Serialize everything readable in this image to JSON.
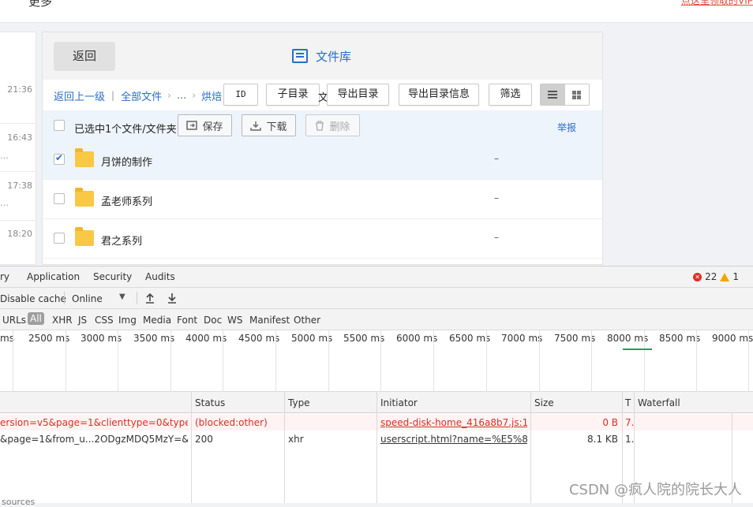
{
  "topbar": {
    "left_text": "更多",
    "right_text": "点这里领取的VIP"
  },
  "chat_list": {
    "times": [
      "21:36",
      "16:43",
      "17:38",
      "18:20"
    ],
    "dots": "…"
  },
  "file_panel": {
    "back_label": "返回",
    "title": "文件库",
    "breadcrumb": {
      "up": "返回上一级",
      "all": "全部文件",
      "dots": "...",
      "current": "烘焙"
    },
    "toolbar": {
      "id": "ID",
      "subdir": "子目录",
      "partial": "文",
      "export_dir": "导出目录",
      "export_dir_info": "导出目录信息",
      "filter": "筛选"
    },
    "selection": {
      "text": "已选中1个文件/文件夹",
      "save": "保存",
      "download": "下载",
      "delete": "删除",
      "report": "举报"
    },
    "rows": [
      {
        "name": "月饼的制作",
        "dash": "–",
        "checked": true
      },
      {
        "name": "孟老师系列",
        "dash": "–",
        "checked": false
      },
      {
        "name": "君之系列",
        "dash": "–",
        "checked": false
      }
    ]
  },
  "devtools": {
    "tabs": [
      "ry",
      "Application",
      "Security",
      "Audits"
    ],
    "errors": "22",
    "warnings": "1",
    "toolbar": {
      "disable_cache": "Disable cache",
      "throttle": "Online"
    },
    "filters": [
      "URLs",
      "All",
      "XHR",
      "JS",
      "CSS",
      "Img",
      "Media",
      "Font",
      "Doc",
      "WS",
      "Manifest",
      "Other"
    ],
    "timeline_ticks": [
      "ms",
      "2500 ms",
      "3000 ms",
      "3500 ms",
      "4000 ms",
      "4500 ms",
      "5000 ms",
      "5500 ms",
      "6000 ms",
      "6500 ms",
      "7000 ms",
      "7500 ms",
      "8000 ms",
      "8500 ms",
      "9000 ms"
    ],
    "columns": [
      "Status",
      "Type",
      "Initiator",
      "Size",
      "T",
      "Waterfall"
    ],
    "requests": [
      {
        "name": "ersion=v5&page=1&clienttype=0&type=...",
        "status": "(blocked:other)",
        "type": "",
        "initiator": "speed-disk-home_416a8b7.js:1",
        "size": "0 B",
        "time": "7."
      },
      {
        "name": "&page=1&from_u...2ODgzMDQ5MzY=&cli...",
        "status": "200",
        "type": "xhr",
        "initiator": "userscript.html?name=%E5%80%...",
        "size": "8.1 KB",
        "time": "1."
      }
    ],
    "bottom_text": "sources"
  },
  "watermark": "CSDN @疯人院的院长大人"
}
